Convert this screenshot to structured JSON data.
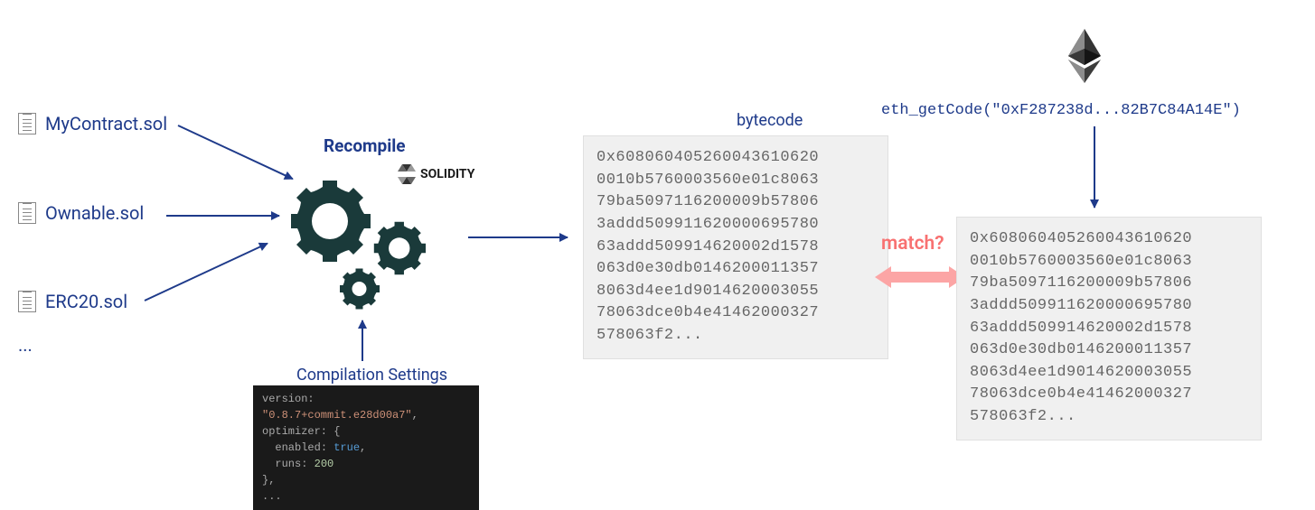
{
  "files": [
    {
      "name": "MyContract.sol"
    },
    {
      "name": "Ownable.sol"
    },
    {
      "name": "ERC20.sol"
    }
  ],
  "ellipsis": "...",
  "recompile": "Recompile",
  "solidity": "SOLIDITY",
  "compilationSettings": "Compilation Settings",
  "settingsCode": {
    "versionKey": "version:",
    "versionVal": "\"0.8.7+commit.e28d00a7\"",
    "optimizerKey": "optimizer:",
    "enabledKey": "enabled:",
    "enabledVal": "true",
    "runsKey": "runs:",
    "runsVal": "200",
    "trailing": "..."
  },
  "bytecodeLabel": "bytecode",
  "bytecode1": "0x6080604052600436106200010b5760003560e01c8\n06379ba5097116200009b578063addd509911620000695\n78063addd509914620002d1578063d0e30db01462000113578063d4ee1d901462000305578063dce0b4e41462000327578063f2...",
  "bytecode2": "0x6080604052600436106200010b5760003560e01c8\n06379ba5097116200009b578063addd509911620000695\n78063addd509914620002d1578063d0e30db01462000113578063d4ee1d901462000305578063dce0b4e41462000327578063f2...",
  "match": "match?",
  "ethCode": "eth_getCode(\"0xF287238d...82B7C84A14E\")"
}
